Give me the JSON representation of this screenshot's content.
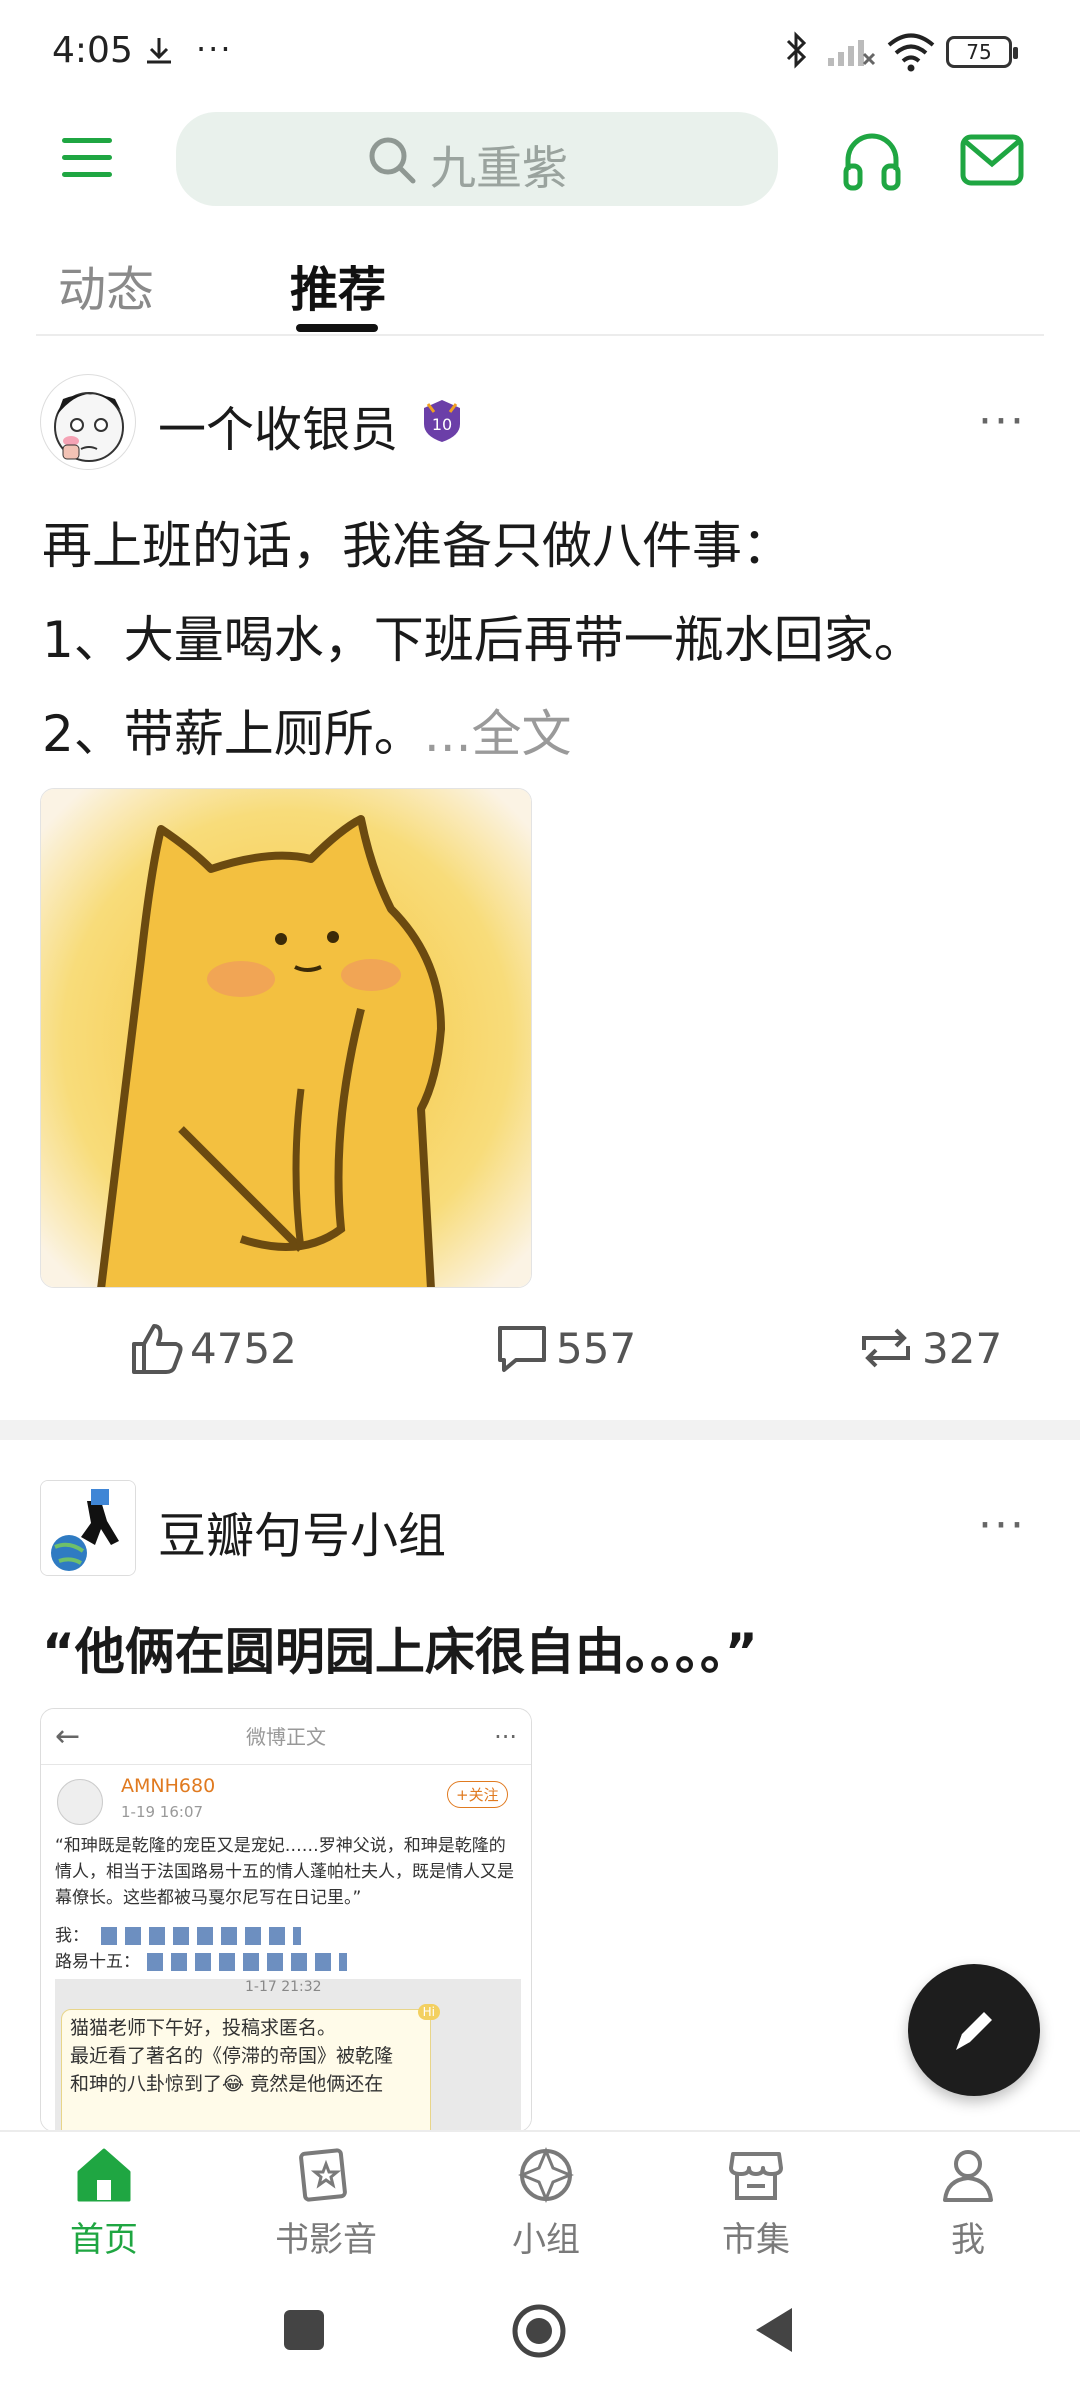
{
  "status_bar": {
    "time": "4:05",
    "battery": "75"
  },
  "search": {
    "placeholder": "九重紫"
  },
  "tabs": [
    {
      "label": "动态"
    },
    {
      "label": "推荐"
    }
  ],
  "posts": [
    {
      "author": "一个收银员",
      "level_badge": "10",
      "lines": [
        "再上班的话，我准备只做八件事：",
        "1、大量喝水，下班后再带一瓶水回家。",
        "2、带薪上厕所。"
      ],
      "more_text": "...全文",
      "likes": "4752",
      "comments": "557",
      "reposts": "327"
    },
    {
      "author": "豆瓣句号小组",
      "title": "“他俩在圆明园上床很自由。。。。”",
      "embedded": {
        "header": "微博正文",
        "user": "AMNH680",
        "follow": "+关注",
        "date": "1-19 16:07",
        "text1": "“和珅既是乾隆的宠臣又是宠妃……罗神父说，和珅是乾隆的情人，相当于法国路易十五的情人蓬帕杜夫人，既是情人又是幕僚长。这些都被马戛尔尼写在日记里。”",
        "me": "我：",
        "louis": "路易十五：",
        "time2": "1-17 21:32",
        "hi": "Hi",
        "msg1": "猫猫老师下午好，投稿求匿名。",
        "msg2": "最近看了著名的《停滞的帝国》被乾隆",
        "msg3": "和珅的八卦惊到了😂 竟然是他俩还在"
      }
    }
  ],
  "bottom_nav": [
    {
      "label": "首页",
      "icon": "home-icon",
      "active": true
    },
    {
      "label": "书影音",
      "icon": "film-icon"
    },
    {
      "label": "小组",
      "icon": "group-icon"
    },
    {
      "label": "市集",
      "icon": "store-icon"
    },
    {
      "label": "我",
      "icon": "profile-icon"
    }
  ],
  "colors": {
    "accent": "#1fa642",
    "search_bg": "#e9f1ec"
  }
}
